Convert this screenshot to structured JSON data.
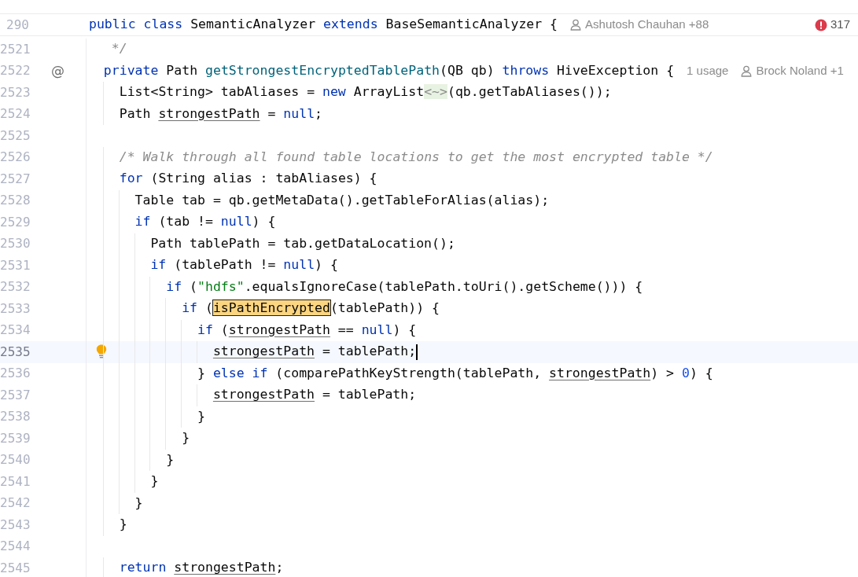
{
  "sticky_header": {
    "line_number": "290",
    "tokens": [
      {
        "text": "public ",
        "kind": "keyword"
      },
      {
        "text": "class",
        "kind": "keyword"
      },
      {
        "text": " SemanticAnalyzer ",
        "kind": "plain"
      },
      {
        "text": "extends",
        "kind": "keyword"
      },
      {
        "text": " BaseSemanticAnalyzer {",
        "kind": "plain"
      }
    ],
    "hints": [
      {
        "kind": "author",
        "text": "Ashutosh Chauhan +88"
      }
    ]
  },
  "error_count": "317",
  "lines": [
    {
      "number": "2521",
      "current": false,
      "tokens": [
        {
          "text": "   */",
          "kind": "comment"
        }
      ]
    },
    {
      "number": "2522",
      "current": false,
      "gutter_mark": {
        "kind": "text",
        "text": "@"
      },
      "tokens": [
        {
          "text": "  private",
          "kind": "keyword"
        },
        {
          "text": " Path ",
          "kind": "plain"
        },
        {
          "text": "getStrongestEncryptedTablePath",
          "kind": "method"
        },
        {
          "text": "(QB qb) ",
          "kind": "plain"
        },
        {
          "text": "throws",
          "kind": "keyword"
        },
        {
          "text": " HiveException {",
          "kind": "plain"
        }
      ],
      "hints": [
        {
          "kind": "usages",
          "text": "1 usage"
        },
        {
          "kind": "author",
          "text": "Brock Noland +1"
        }
      ]
    },
    {
      "number": "2523",
      "current": false,
      "tokens": [
        {
          "text": "    List<String> tabAliases = ",
          "kind": "plain"
        },
        {
          "text": "new",
          "kind": "keyword"
        },
        {
          "text": " ArrayList",
          "kind": "plain"
        },
        {
          "text": "<~>",
          "kind": "folded"
        },
        {
          "text": "(qb.getTabAliases());",
          "kind": "plain"
        }
      ]
    },
    {
      "number": "2524",
      "current": false,
      "tokens": [
        {
          "text": "    Path ",
          "kind": "plain"
        },
        {
          "text": "strongestPath",
          "kind": "reassigned"
        },
        {
          "text": " = ",
          "kind": "plain"
        },
        {
          "text": "null",
          "kind": "keyword"
        },
        {
          "text": ";",
          "kind": "plain"
        }
      ]
    },
    {
      "number": "2525",
      "current": false
    },
    {
      "number": "2526",
      "current": false,
      "tokens": [
        {
          "text": "    /* Walk through all found table locations to get the most encrypted table */",
          "kind": "comment"
        }
      ]
    },
    {
      "number": "2527",
      "current": false,
      "tokens": [
        {
          "text": "    for",
          "kind": "keyword"
        },
        {
          "text": " (String alias : tabAliases) {",
          "kind": "plain"
        }
      ]
    },
    {
      "number": "2528",
      "current": false,
      "tokens": [
        {
          "text": "      Table tab = qb.getMetaData().getTableForAlias(alias);",
          "kind": "plain"
        }
      ]
    },
    {
      "number": "2529",
      "current": false,
      "tokens": [
        {
          "text": "      if",
          "kind": "keyword"
        },
        {
          "text": " (tab != ",
          "kind": "plain"
        },
        {
          "text": "null",
          "kind": "keyword"
        },
        {
          "text": ") {",
          "kind": "plain"
        }
      ]
    },
    {
      "number": "2530",
      "current": false,
      "tokens": [
        {
          "text": "        Path tablePath = tab.getDataLocation();",
          "kind": "plain"
        }
      ]
    },
    {
      "number": "2531",
      "current": false,
      "tokens": [
        {
          "text": "        if",
          "kind": "keyword"
        },
        {
          "text": " (tablePath != ",
          "kind": "plain"
        },
        {
          "text": "null",
          "kind": "keyword"
        },
        {
          "text": ") {",
          "kind": "plain"
        }
      ]
    },
    {
      "number": "2532",
      "current": false,
      "tokens": [
        {
          "text": "          if",
          "kind": "keyword"
        },
        {
          "text": " (",
          "kind": "plain"
        },
        {
          "text": "\"hdfs\"",
          "kind": "string"
        },
        {
          "text": ".equalsIgnoreCase(tablePath.toUri().getScheme())) {",
          "kind": "plain"
        }
      ]
    },
    {
      "number": "2533",
      "current": false,
      "tokens": [
        {
          "text": "            if",
          "kind": "keyword"
        },
        {
          "text": " (",
          "kind": "plain"
        },
        {
          "text": "isPathEncrypted",
          "kind": "highlighted"
        },
        {
          "text": "(tablePath)) {",
          "kind": "plain"
        }
      ]
    },
    {
      "number": "2534",
      "current": false,
      "tokens": [
        {
          "text": "              if",
          "kind": "keyword"
        },
        {
          "text": " (",
          "kind": "plain"
        },
        {
          "text": "strongestPath",
          "kind": "reassigned"
        },
        {
          "text": " == ",
          "kind": "plain"
        },
        {
          "text": "null",
          "kind": "keyword"
        },
        {
          "text": ") {",
          "kind": "plain"
        }
      ]
    },
    {
      "number": "2535",
      "current": true,
      "gutter_mark": {
        "kind": "bulb"
      },
      "tokens": [
        {
          "text": "                strongestPath",
          "kind": "reassigned"
        },
        {
          "text": " = tablePath;",
          "kind": "plain"
        }
      ]
    },
    {
      "number": "2536",
      "current": false,
      "tokens": [
        {
          "text": "              } ",
          "kind": "plain"
        },
        {
          "text": "else if",
          "kind": "keyword"
        },
        {
          "text": " (comparePathKeyStrength(tablePath, ",
          "kind": "plain"
        },
        {
          "text": "strongestPath",
          "kind": "reassigned"
        },
        {
          "text": ") > ",
          "kind": "plain"
        },
        {
          "text": "0",
          "kind": "number"
        },
        {
          "text": ") {",
          "kind": "plain"
        }
      ]
    },
    {
      "number": "2537",
      "current": false,
      "tokens": [
        {
          "text": "                strongestPath",
          "kind": "reassigned"
        },
        {
          "text": " = tablePath;",
          "kind": "plain"
        }
      ]
    },
    {
      "number": "2538",
      "current": false,
      "tokens": [
        {
          "text": "              }",
          "kind": "plain"
        }
      ]
    },
    {
      "number": "2539",
      "current": false,
      "tokens": [
        {
          "text": "            }",
          "kind": "plain"
        }
      ]
    },
    {
      "number": "2540",
      "current": false,
      "tokens": [
        {
          "text": "          }",
          "kind": "plain"
        }
      ]
    },
    {
      "number": "2541",
      "current": false,
      "tokens": [
        {
          "text": "        }",
          "kind": "plain"
        }
      ]
    },
    {
      "number": "2542",
      "current": false,
      "tokens": [
        {
          "text": "      }",
          "kind": "plain"
        }
      ]
    },
    {
      "number": "2543",
      "current": false,
      "tokens": [
        {
          "text": "    }",
          "kind": "plain"
        }
      ]
    },
    {
      "number": "2544",
      "current": false
    },
    {
      "number": "2545",
      "current": false,
      "tokens": [
        {
          "text": "    return ",
          "kind": "keyword"
        },
        {
          "text": "strongestPath",
          "kind": "reassigned"
        },
        {
          "text": ";",
          "kind": "plain"
        }
      ]
    }
  ]
}
